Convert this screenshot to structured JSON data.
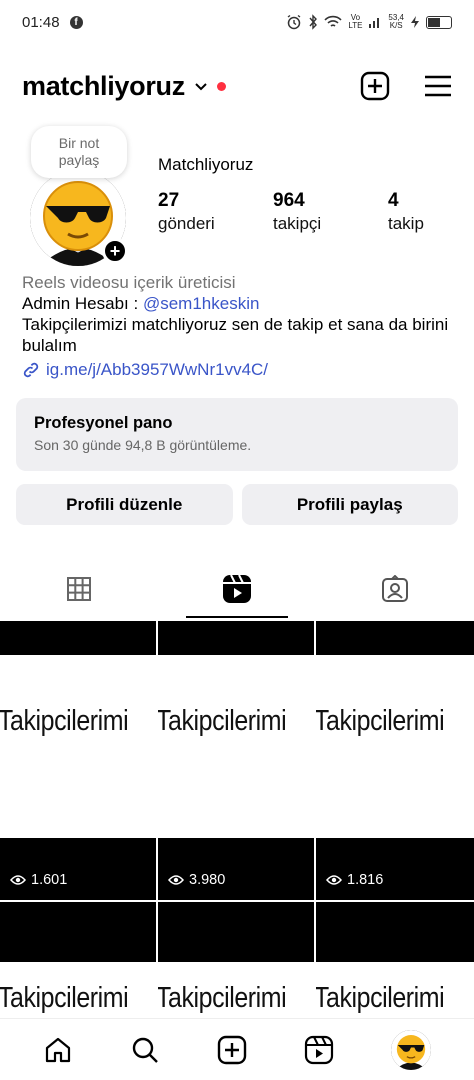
{
  "status_bar": {
    "time": "01:48",
    "net_top": "Vo",
    "net_bottom": "LTE",
    "speed_top": "53,4",
    "speed_bottom": "K/S"
  },
  "header": {
    "username": "matchliyoruz"
  },
  "profile": {
    "note_text": "Bir not paylaş",
    "display_name": "Matchliyoruz",
    "stats": [
      {
        "value": "27",
        "label": "gönderi"
      },
      {
        "value": "964",
        "label": "takipçi"
      },
      {
        "value": "4",
        "label": "takip"
      }
    ],
    "bio": {
      "category": "Reels videosu içerik üreticisi",
      "admin_prefix": "Admin Hesabı : ",
      "admin_mention": "@sem1hkeskin",
      "description": "Takipçilerimizi matchliyoruz sen de takip et sana da birini bulalım",
      "link": "ig.me/j/Abb3957WwNr1vv4C/"
    }
  },
  "pro_dashboard": {
    "title": "Profesyonel pano",
    "subtitle": "Son 30 günde 94,8 B görüntüleme."
  },
  "buttons": {
    "edit_profile": "Profili düzenle",
    "share_profile": "Profili paylaş"
  },
  "grid": {
    "row1": [
      {
        "text": "Takipcilerimi",
        "views": "1.601"
      },
      {
        "text": "Takipcilerimi",
        "views": "3.980"
      },
      {
        "text": "Takipcilerimi",
        "views": "1.816"
      }
    ],
    "row2": [
      {
        "text": "Takipcilerimi"
      },
      {
        "text": "Takipcilerimi"
      },
      {
        "text": "Takipcilerimi"
      }
    ]
  },
  "colors": {
    "link_blue": "#3a55c8",
    "notification_red": "#ff3040",
    "panel_gray": "#efeff2"
  }
}
